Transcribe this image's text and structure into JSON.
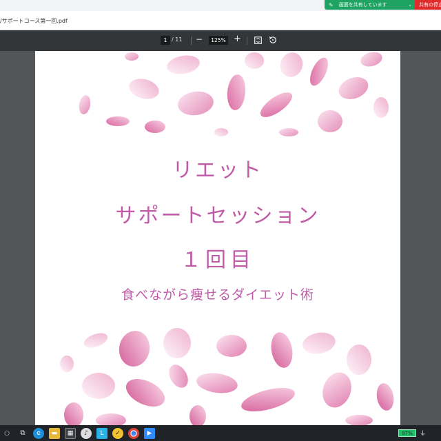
{
  "share_bar": {
    "sharing_label": "画面を共有しています",
    "stop_label": "共有の停止"
  },
  "address": {
    "tab_path": "/サポートコース第一回.pdf"
  },
  "pdf_toolbar": {
    "current_page": "1",
    "page_separator": "/ 11",
    "zoom_level": "125%",
    "zoom_out_label": "−",
    "zoom_in_label": "+"
  },
  "document": {
    "line1": "リエット",
    "line2": "サポートセッション",
    "line3": "１回目",
    "subtitle": "食べながら痩せるダイエット術"
  },
  "taskbar": {
    "battery_label": "97%"
  },
  "colors": {
    "title_pink": "#c05ba8",
    "share_green": "#1ea362",
    "share_red": "#e22b2b"
  }
}
